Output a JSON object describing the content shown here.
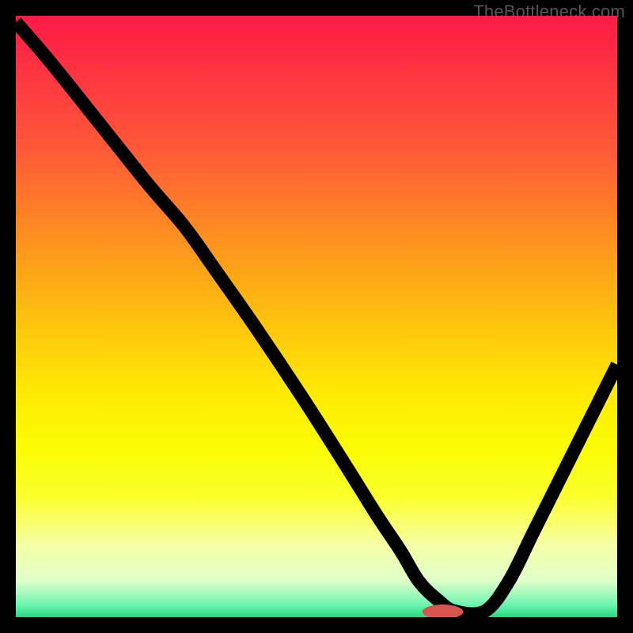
{
  "watermark": "TheBottleneck.com",
  "colors": {
    "black": "#000000",
    "curve": "#000000",
    "marker": "#d9534f"
  },
  "chart_data": {
    "type": "line",
    "title": "",
    "xlabel": "",
    "ylabel": "",
    "xlim": [
      0,
      100
    ],
    "ylim": [
      0,
      100
    ],
    "gradient_stops": [
      {
        "offset": 0.0,
        "color": "#fe1a47"
      },
      {
        "offset": 0.22,
        "color": "#fe5838"
      },
      {
        "offset": 0.45,
        "color": "#feae14"
      },
      {
        "offset": 0.62,
        "color": "#fee804"
      },
      {
        "offset": 0.72,
        "color": "#fbfd03"
      },
      {
        "offset": 0.8,
        "color": "#faff2c"
      },
      {
        "offset": 0.88,
        "color": "#f6ffa6"
      },
      {
        "offset": 0.94,
        "color": "#deffca"
      },
      {
        "offset": 0.98,
        "color": "#6af4ae"
      },
      {
        "offset": 1.0,
        "color": "#26d882"
      }
    ],
    "series": [
      {
        "name": "bottleneck-curve",
        "x": [
          0,
          6,
          14,
          22,
          28,
          33,
          40,
          48,
          55,
          60,
          64,
          67,
          70,
          73,
          78,
          82,
          86,
          90,
          95,
          100
        ],
        "y": [
          99,
          92,
          82,
          72,
          65,
          58,
          48,
          36,
          25,
          17,
          11,
          6,
          3,
          1,
          1,
          6,
          14,
          22,
          32,
          42
        ]
      }
    ],
    "marker": {
      "x": 71,
      "y": 0.9,
      "rx": 3.4,
      "ry": 1.2
    }
  }
}
